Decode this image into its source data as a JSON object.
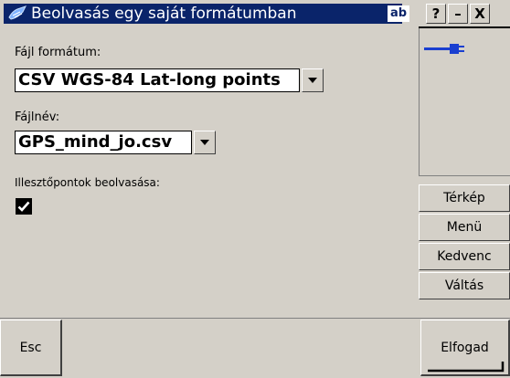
{
  "window": {
    "title": "Beolvasás egy saját formátumban",
    "input_mode": "ab",
    "help_label": "?",
    "minimize_label": "–",
    "close_label": "X"
  },
  "form": {
    "file_format_label": "Fájl formátum:",
    "file_format_value": "CSV WGS-84 Lat-long points",
    "file_name_label": "Fájlnév:",
    "file_name_value": "GPS_mind_jo.csv",
    "control_points_label": "Illesztőpontok beolvasása:",
    "control_points_checked": true
  },
  "side_panel": {
    "connection_icon": "cable-plug-icon",
    "buttons": [
      "Térkép",
      "Menü",
      "Kedvenc",
      "Váltás"
    ]
  },
  "bottom": {
    "esc_label": "Esc",
    "accept_label": "Elfogad"
  },
  "colors": {
    "title_bar": "#0a246a",
    "background": "#d4d0c8",
    "cable_icon": "#1a3fd0"
  }
}
